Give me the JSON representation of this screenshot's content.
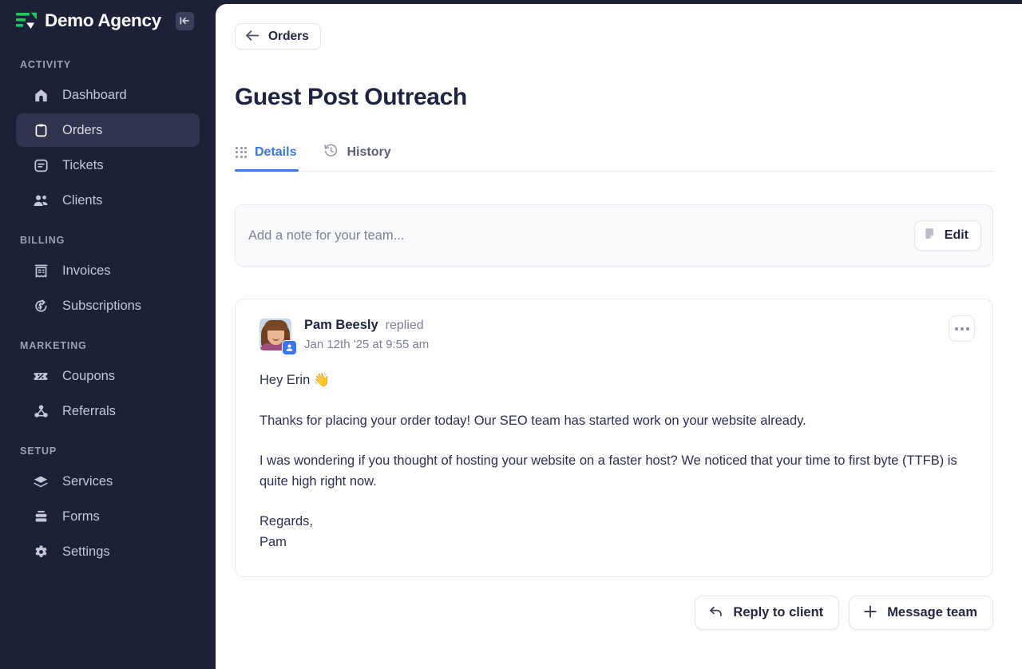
{
  "brand": {
    "name": "Demo Agency",
    "logo_icon": "bars-logo-icon",
    "collapse_icon": "collapse-sidebar-icon"
  },
  "sidebar": {
    "sections": [
      {
        "heading": "ACTIVITY",
        "items": [
          {
            "label": "Dashboard",
            "icon": "home-icon",
            "active": false
          },
          {
            "label": "Orders",
            "icon": "clipboard-icon",
            "active": true
          },
          {
            "label": "Tickets",
            "icon": "message-square-icon",
            "active": false
          },
          {
            "label": "Clients",
            "icon": "users-icon",
            "active": false
          }
        ]
      },
      {
        "heading": "BILLING",
        "items": [
          {
            "label": "Invoices",
            "icon": "receipt-icon",
            "active": false
          },
          {
            "label": "Subscriptions",
            "icon": "dollar-refresh-icon",
            "active": false
          }
        ]
      },
      {
        "heading": "MARKETING",
        "items": [
          {
            "label": "Coupons",
            "icon": "ticket-percent-icon",
            "active": false
          },
          {
            "label": "Referrals",
            "icon": "share-network-icon",
            "active": false
          }
        ]
      },
      {
        "heading": "SETUP",
        "items": [
          {
            "label": "Services",
            "icon": "layers-icon",
            "active": false
          },
          {
            "label": "Forms",
            "icon": "form-stack-icon",
            "active": false
          },
          {
            "label": "Settings",
            "icon": "gear-icon",
            "active": false
          }
        ]
      }
    ]
  },
  "main": {
    "back_button": {
      "label": "Orders",
      "icon": "arrow-left-icon"
    },
    "page_title": "Guest Post Outreach",
    "tabs": [
      {
        "label": "Details",
        "icon": "grid-dots-icon",
        "active": true
      },
      {
        "label": "History",
        "icon": "history-clock-icon",
        "active": false
      }
    ],
    "note": {
      "placeholder": "Add a note for your team...",
      "edit_label": "Edit",
      "edit_icon": "sticky-note-icon"
    },
    "message": {
      "author": "Pam Beesly",
      "verb": "replied",
      "timestamp": "Jan 12th '25 at 9:55 am",
      "avatar_badge_icon": "user-badge-icon",
      "more_icon": "more-horizontal-icon",
      "paragraphs": [
        "Hey Erin 👋",
        "Thanks for placing your order today! Our SEO team has started work on your website already.",
        "I was wondering if you thought of hosting your website on a faster host? We noticed that your time to first byte (TTFB) is quite high right now.",
        "Regards,\nPam"
      ]
    },
    "actions": [
      {
        "label": "Reply to client",
        "icon": "reply-arrow-icon"
      },
      {
        "label": "Message team",
        "icon": "plus-icon"
      }
    ]
  },
  "colors": {
    "sidebar_bg": "#1d2137",
    "sidebar_active": "#30344c",
    "accent_blue": "#3b76e8",
    "logo_green": "#22c55e",
    "text_dark": "#1e2340",
    "text_muted": "#7d8297"
  }
}
